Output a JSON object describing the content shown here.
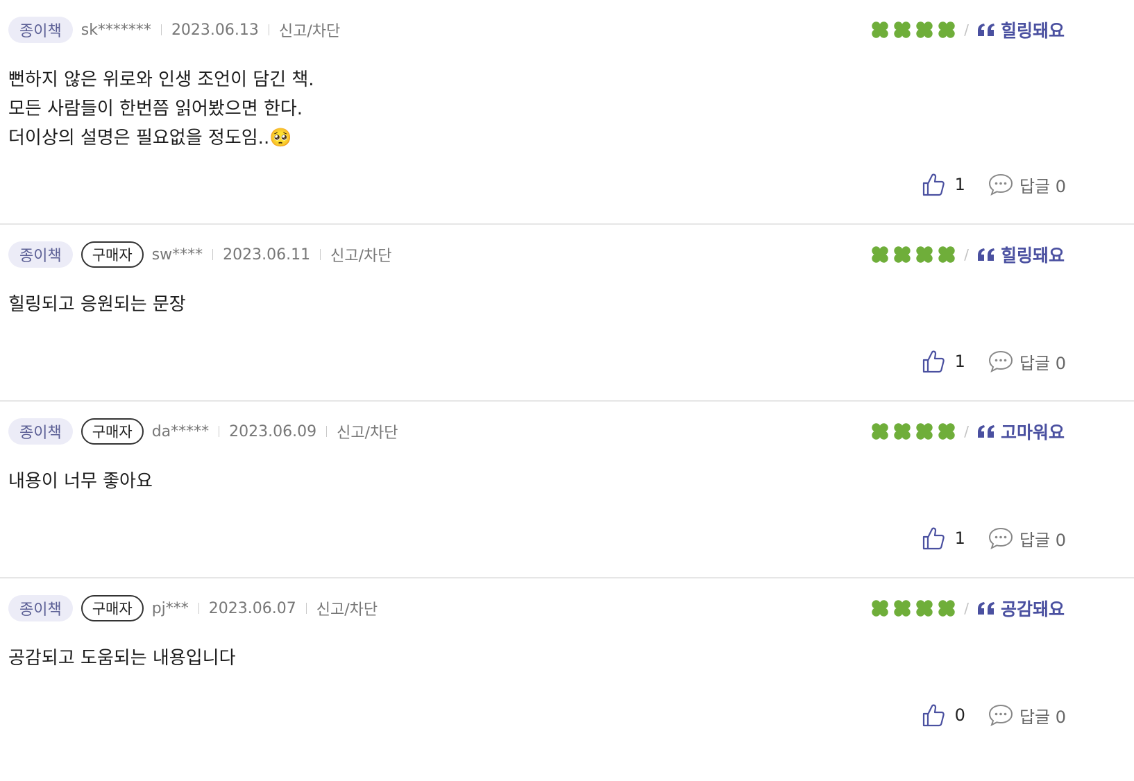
{
  "reviews": [
    {
      "format_badge": "종이책",
      "buyer_badge": "",
      "user_id": "sk*******",
      "date": "2023.06.13",
      "report_label": "신고/차단",
      "rating": 4,
      "tag": "힐링돼요",
      "body_lines": [
        "뻔하지 않은 위로와 인생 조언이 담긴 책.",
        "모든 사람들이 한번쯤 읽어봤으면 한다.",
        "더이상의 설명은 필요없을 정도임..🥺"
      ],
      "likes": "1",
      "reply_label": "답글 0"
    },
    {
      "format_badge": "종이책",
      "buyer_badge": "구매자",
      "user_id": "sw****",
      "date": "2023.06.11",
      "report_label": "신고/차단",
      "rating": 4,
      "tag": "힐링돼요",
      "body_lines": [
        "힐링되고 응원되는 문장"
      ],
      "likes": "1",
      "reply_label": "답글 0"
    },
    {
      "format_badge": "종이책",
      "buyer_badge": "구매자",
      "user_id": "da*****",
      "date": "2023.06.09",
      "report_label": "신고/차단",
      "rating": 4,
      "tag": "고마워요",
      "body_lines": [
        "내용이 너무 좋아요"
      ],
      "likes": "1",
      "reply_label": "답글 0"
    },
    {
      "format_badge": "종이책",
      "buyer_badge": "구매자",
      "user_id": "pj***",
      "date": "2023.06.07",
      "report_label": "신고/차단",
      "rating": 4,
      "tag": "공감돼요",
      "body_lines": [
        "공감되고 도움되는 내용입니다"
      ],
      "likes": "0",
      "reply_label": "답글 0"
    }
  ],
  "colors": {
    "clover": "#6fae3a",
    "tag": "#4a50a0",
    "paper_badge_bg": "#ececf7",
    "paper_badge_text": "#5b5f95",
    "divider": "#e6e6e6"
  },
  "icons": {
    "rating": "clover-icon",
    "tag": "quote-icon",
    "like": "thumbs-up-icon",
    "reply": "speech-bubble-icon"
  }
}
